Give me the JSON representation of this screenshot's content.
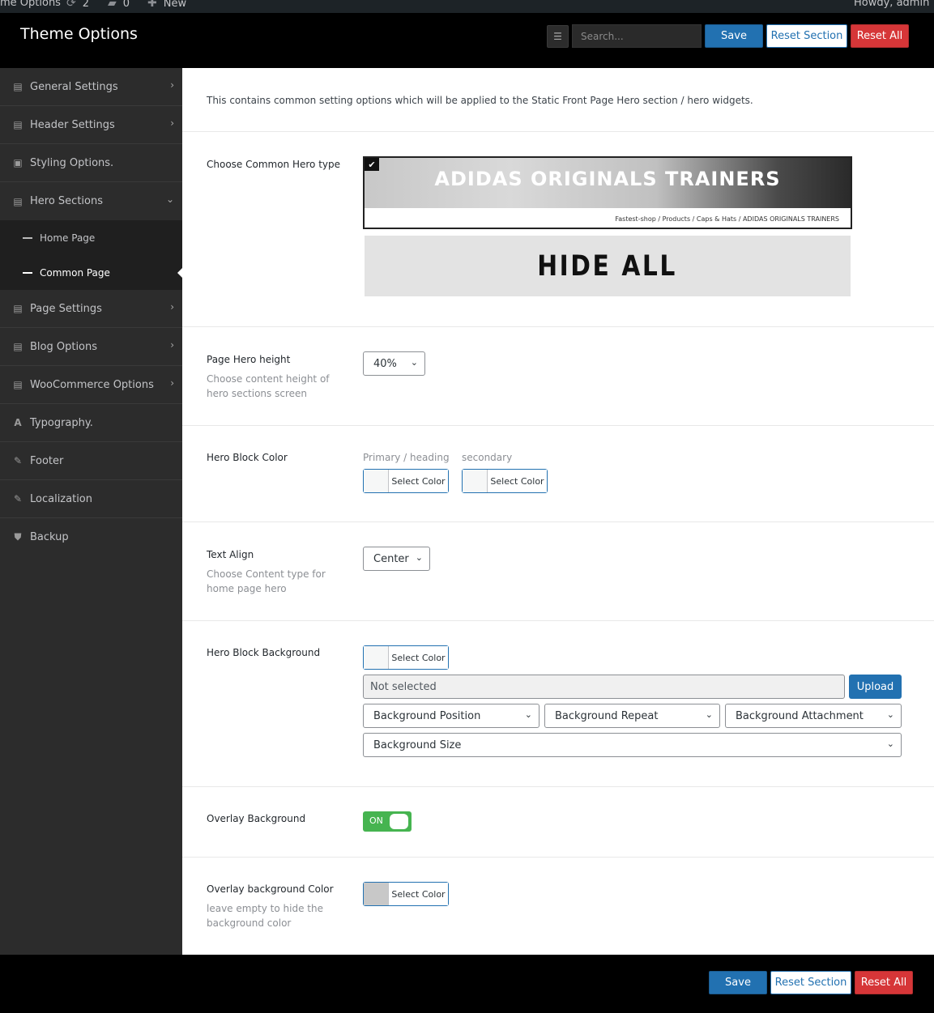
{
  "adminbar": {
    "site": "me Options",
    "updates": "2",
    "comments": "0",
    "new": "New",
    "howdy": "Howdy, admin"
  },
  "header": {
    "title": "Theme Options",
    "search_placeholder": "Search...",
    "save": "Save",
    "reset_section": "Reset Section",
    "reset_all": "Reset All"
  },
  "sidebar": {
    "items": [
      {
        "label": "General Settings",
        "icon": "settings-icon"
      },
      {
        "label": "Header Settings",
        "icon": "settings-icon"
      },
      {
        "label": "Styling Options.",
        "icon": "styling-icon"
      },
      {
        "label": "Hero Sections",
        "icon": "settings-icon"
      },
      {
        "label": "Page Settings",
        "icon": "settings-icon"
      },
      {
        "label": "Blog Options",
        "icon": "settings-icon"
      },
      {
        "label": "WooCommerce Options",
        "icon": "settings-icon"
      },
      {
        "label": "Typography.",
        "icon": "font-icon"
      },
      {
        "label": "Footer",
        "icon": "edit-icon"
      },
      {
        "label": "Localization",
        "icon": "edit-icon"
      },
      {
        "label": "Backup",
        "icon": "shield-icon"
      }
    ],
    "hero_sub": [
      "Home Page",
      "Common Page"
    ]
  },
  "main": {
    "description": "This contains common setting options which will be applied to the Static Front Page Hero section / hero widgets.",
    "hero_type": {
      "label": "Choose Common Hero type",
      "option1_title": "ADIDAS ORIGINALS TRAINERS",
      "option1_crumbs": "Fastest-shop /  Products /  Caps & Hats /  ADIDAS ORIGINALS TRAINERS",
      "option2_title": "HIDE ALL"
    },
    "hero_height": {
      "label": "Page Hero height",
      "sublabel": "Choose content height of hero sections screen",
      "value": "40%"
    },
    "hero_block_color": {
      "label": "Hero Block Color",
      "primary_label": "Primary / heading",
      "secondary_label": "secondary",
      "button": "Select Color"
    },
    "text_align": {
      "label": "Text Align",
      "sublabel": "Choose Content type for home page hero",
      "value": "Center"
    },
    "hero_block_bg": {
      "label": "Hero Block Background",
      "button": "Select Color",
      "media": "Not selected",
      "upload": "Upload",
      "position": "Background Position",
      "repeat": "Background Repeat",
      "attachment": "Background Attachment",
      "size": "Background Size"
    },
    "overlay_bg": {
      "label": "Overlay Background",
      "toggle": "ON"
    },
    "overlay_bg_color": {
      "label": "Overlay background Color",
      "sublabel": "leave empty to hide the background color",
      "button": "Select Color"
    }
  },
  "footer": {
    "save": "Save",
    "reset_section": "Reset Section",
    "reset_all": "Reset All"
  }
}
